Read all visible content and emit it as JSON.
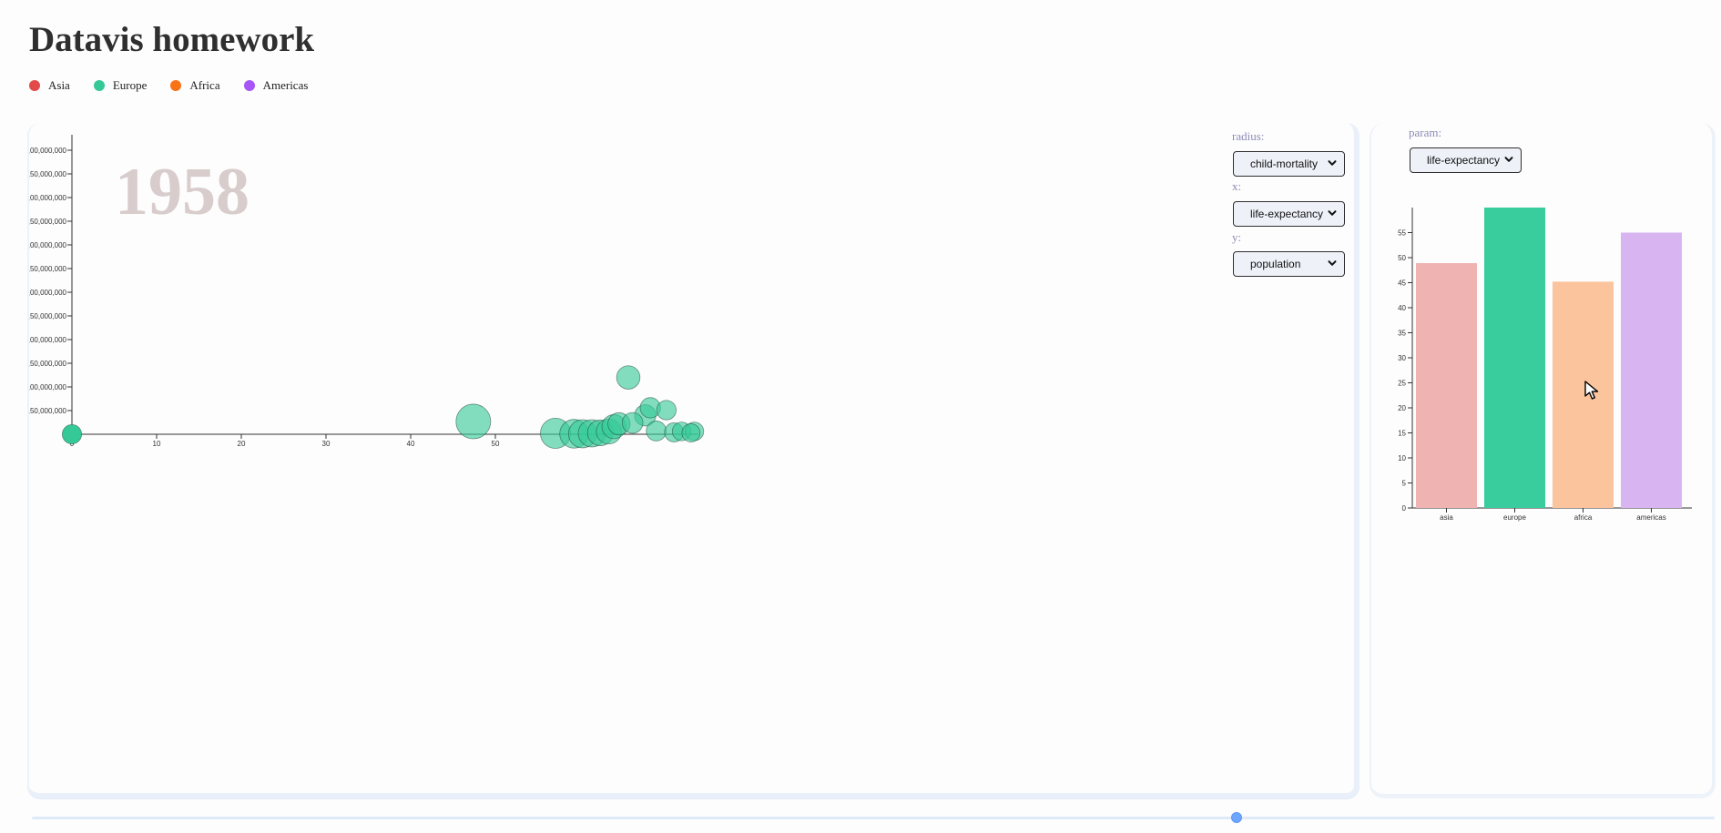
{
  "header": {
    "title": "Datavis homework"
  },
  "legend": {
    "items": [
      {
        "label": "Asia",
        "color": "#e34a4a"
      },
      {
        "label": "Europe",
        "color": "#35c997"
      },
      {
        "label": "Africa",
        "color": "#f97316"
      },
      {
        "label": "Americas",
        "color": "#a855f7"
      }
    ]
  },
  "controls": {
    "radius_label": "radius:",
    "radius_value": "child-mortality",
    "x_label": "x:",
    "x_value": "life-expectancy",
    "y_label": "y:",
    "y_value": "population",
    "param_label": "param:",
    "param_value": "life-expectancy"
  },
  "slider": {
    "year": "1958"
  },
  "icons": {
    "dropdown": "chevron-down-icon",
    "cursor": "mouse-pointer-icon"
  },
  "chart_data": [
    {
      "type": "scatter",
      "year": "1958",
      "xlabel": "",
      "ylabel": "",
      "xlim": [
        0,
        75
      ],
      "ylim": [
        0,
        650000000
      ],
      "grid": false,
      "x_ticks": [
        "0",
        "10",
        "20",
        "30",
        "40",
        "50"
      ],
      "y_ticks": [
        ",50,000,000",
        ",00,000,000",
        ",50,000,000",
        ",00,000,000",
        ",50,000,000",
        ",00,000,000",
        ",50,000,000",
        ",00,000,000",
        ",50,000,000",
        ",00,000,000",
        ",50,000,000",
        ",00,000,000"
      ],
      "series": [
        {
          "points": [
            {
              "x": 0,
              "y": 0,
              "r": 45,
              "color": "#35c997"
            },
            {
              "x": 47.4,
              "y": 27000000,
              "r": 145,
              "color": "#35c997"
            },
            {
              "x": 57.1,
              "y": 2000000,
              "r": 110,
              "color": "#35c997"
            },
            {
              "x": 59.3,
              "y": 1000000,
              "r": 100,
              "color": "#35c997"
            },
            {
              "x": 60.3,
              "y": 1000000,
              "r": 96,
              "color": "#35c997"
            },
            {
              "x": 61.4,
              "y": 2000000,
              "r": 90,
              "color": "#35c997"
            },
            {
              "x": 62.4,
              "y": 3000000,
              "r": 80,
              "color": "#35c997"
            },
            {
              "x": 63.4,
              "y": 6000000,
              "r": 76,
              "color": "#35c997"
            },
            {
              "x": 64.0,
              "y": 16000000,
              "r": 70,
              "color": "#35c997"
            },
            {
              "x": 64.6,
              "y": 22000000,
              "r": 60,
              "color": "#35c997"
            },
            {
              "x": 65.7,
              "y": 120000000,
              "r": 66,
              "color": "#35c997"
            },
            {
              "x": 66.2,
              "y": 24000000,
              "r": 52,
              "color": "#35c997"
            },
            {
              "x": 67.7,
              "y": 40000000,
              "r": 55,
              "color": "#35c997"
            },
            {
              "x": 68.3,
              "y": 56000000,
              "r": 50,
              "color": "#35c997"
            },
            {
              "x": 69.0,
              "y": 7000000,
              "r": 48,
              "color": "#35c997"
            },
            {
              "x": 70.2,
              "y": 51000000,
              "r": 46,
              "color": "#35c997"
            },
            {
              "x": 71.1,
              "y": 4000000,
              "r": 44,
              "color": "#35c997"
            },
            {
              "x": 72.0,
              "y": 6000000,
              "r": 42,
              "color": "#35c997"
            },
            {
              "x": 73.1,
              "y": 3000000,
              "r": 40,
              "color": "#35c997"
            },
            {
              "x": 73.5,
              "y": 6000000,
              "r": 42,
              "color": "#35c997"
            }
          ]
        }
      ]
    },
    {
      "type": "bar",
      "title": "",
      "xlabel": "",
      "ylabel": "",
      "categories": [
        "asia",
        "europe",
        "africa",
        "americas"
      ],
      "values": [
        48.9,
        60.0,
        45.2,
        55.0
      ],
      "ylim": [
        0,
        60
      ],
      "y_ticks": [
        "0",
        "5",
        "10",
        "15",
        "20",
        "25",
        "30",
        "35",
        "40",
        "45",
        "50",
        "55"
      ],
      "colors": [
        "#efb3b1",
        "#39cc9d",
        "#fbc49c",
        "#d8b5f0"
      ]
    }
  ]
}
